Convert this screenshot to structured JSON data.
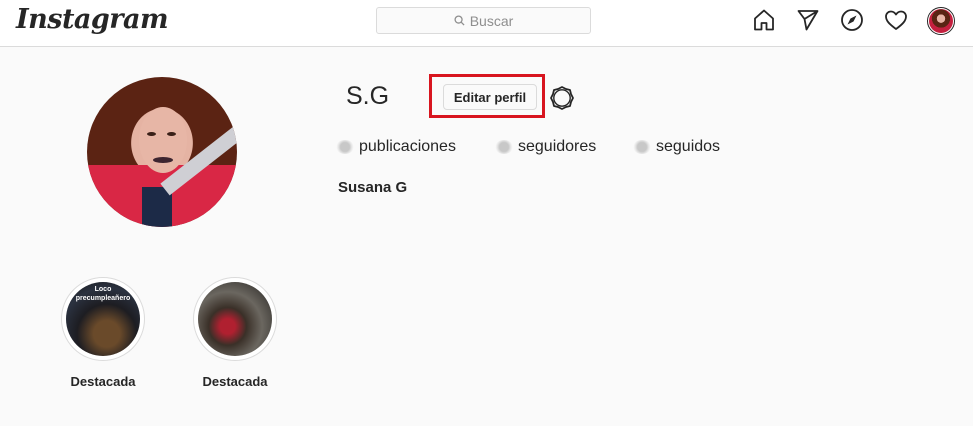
{
  "header": {
    "logo": "Instagram",
    "search_placeholder": "Buscar",
    "nav_icons": [
      "home-icon",
      "direct-icon",
      "explore-icon",
      "activity-icon",
      "profile-avatar"
    ]
  },
  "profile": {
    "username": "S.G",
    "edit_label": "Editar perfil",
    "stats": {
      "posts_label": "publicaciones",
      "followers_label": "seguidores",
      "following_label": "seguidos"
    },
    "full_name": "Susana G"
  },
  "highlights": [
    {
      "label": "Destacada",
      "overlay_line1": "Loco",
      "overlay_line2": "precumpleañero"
    },
    {
      "label": "Destacada"
    }
  ],
  "colors": {
    "highlight_box": "#d8151f",
    "text": "#262626",
    "muted": "#8e8e8e",
    "border": "#dbdbdb"
  }
}
